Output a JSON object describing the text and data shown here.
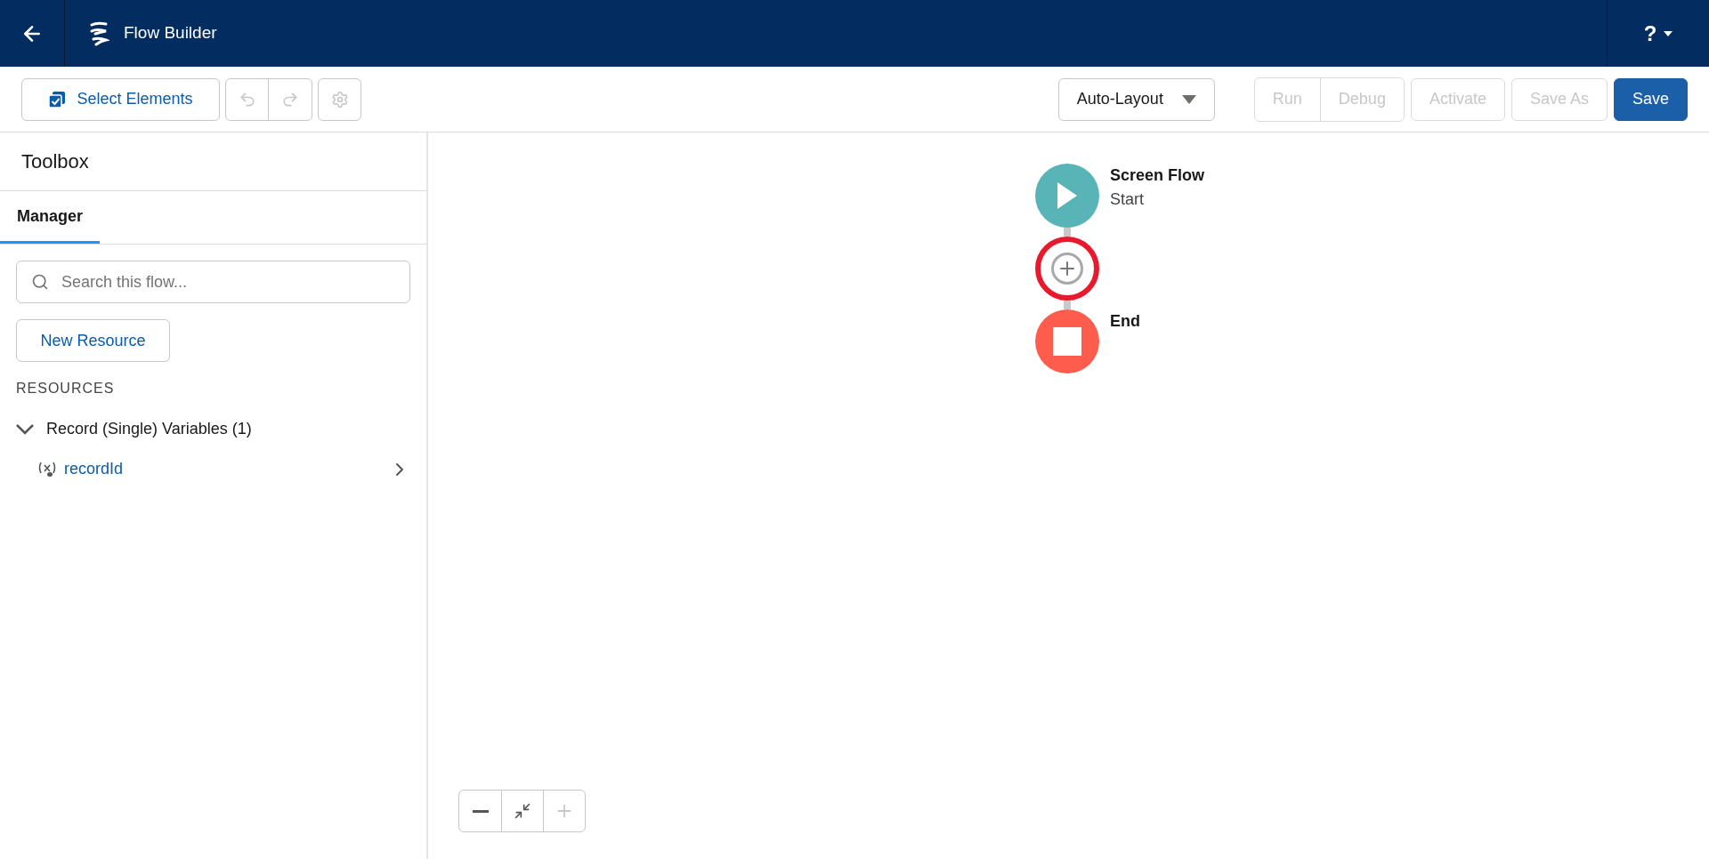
{
  "header": {
    "title": "Flow Builder",
    "help_label": "?"
  },
  "toolbar": {
    "select_elements": "Select Elements",
    "undo": {
      "disabled": true
    },
    "redo": {
      "disabled": true
    },
    "settings": {
      "disabled": true
    },
    "layout_dropdown": "Auto-Layout",
    "actions": [
      {
        "label": "Run",
        "disabled": true,
        "kind": "grouped"
      },
      {
        "label": "Debug",
        "disabled": true,
        "kind": "grouped"
      },
      {
        "label": "Activate",
        "disabled": true,
        "kind": "plain"
      },
      {
        "label": "Save As",
        "disabled": true,
        "kind": "plain"
      },
      {
        "label": "Save",
        "disabled": false,
        "kind": "primary"
      }
    ]
  },
  "sidebar": {
    "title": "Toolbox",
    "tabs": [
      {
        "label": "Manager",
        "selected": true
      }
    ],
    "search": {
      "placeholder": "Search this flow..."
    },
    "new_resource": "New Resource",
    "section_label": "RESOURCES",
    "tree": [
      {
        "label": "Record (Single) Variables (1)",
        "expanded": true,
        "children": [
          {
            "label": "recordId"
          }
        ]
      }
    ]
  },
  "canvas": {
    "nodes": [
      {
        "kind": "start",
        "title": "Screen Flow",
        "subtitle": "Start"
      },
      {
        "kind": "add",
        "highlighted": true
      },
      {
        "kind": "end",
        "title": "End"
      }
    ],
    "zoom_controls": [
      {
        "kind": "zoom-out",
        "disabled": false
      },
      {
        "kind": "fit",
        "disabled": false
      },
      {
        "kind": "zoom-in",
        "disabled": true
      }
    ]
  }
}
